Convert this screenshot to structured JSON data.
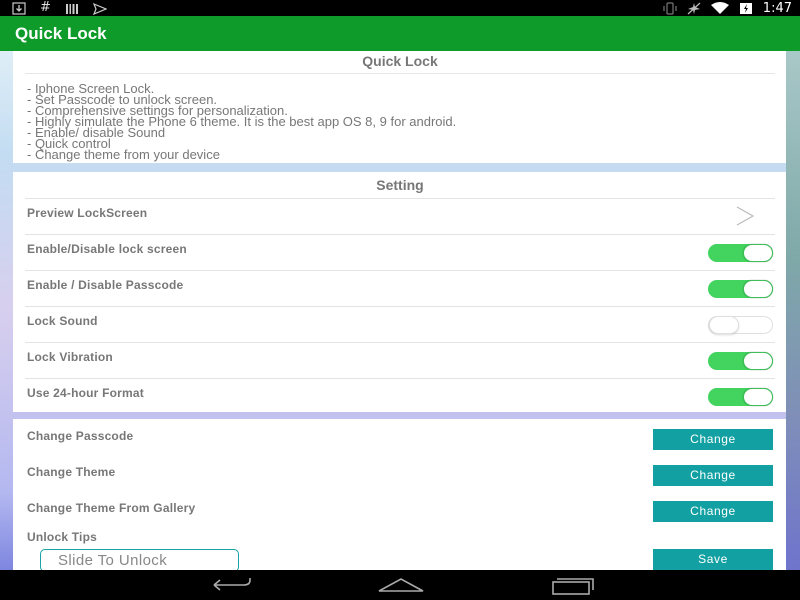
{
  "status_bar": {
    "time": "1:47",
    "left_icons": [
      "download-icon",
      "hashtag-icon",
      "barcode-icon",
      "send-icon"
    ],
    "right_icons": [
      "vibrate-icon",
      "airplane-icon",
      "wifi-icon",
      "battery-icon"
    ]
  },
  "app_bar": {
    "title": "Quick Lock"
  },
  "about": {
    "title": "Quick Lock",
    "lines": [
      "- Iphone Screen Lock.",
      "- Set Passcode to unlock screen.",
      "- Comprehensive settings for personalization.",
      "- Highly simulate the Phone 6 theme. It is the best app OS 8, 9 for android.",
      "- Enable/ disable Sound",
      "- Quick control",
      "- Change theme from your device"
    ]
  },
  "settings": {
    "title": "Setting",
    "rows": [
      {
        "label": "Preview LockScreen",
        "control": "chevron"
      },
      {
        "label": "Enable/Disable lock screen",
        "control": "toggle",
        "on": true
      },
      {
        "label": "Enable / Disable Passcode",
        "control": "toggle",
        "on": true
      },
      {
        "label": "Lock Sound",
        "control": "toggle",
        "on": false
      },
      {
        "label": "Lock Vibration",
        "control": "toggle",
        "on": true
      },
      {
        "label": "Use 24-hour Format",
        "control": "toggle",
        "on": true
      }
    ]
  },
  "actions": {
    "change_passcode": {
      "label": "Change Passcode",
      "button": "Change"
    },
    "change_theme": {
      "label": "Change Theme",
      "button": "Change"
    },
    "change_theme_gallery": {
      "label": "Change Theme From Gallery",
      "button": "Change"
    },
    "unlock_tips": {
      "label": "Unlock Tips",
      "value": "Slide To Unlock",
      "button": "Save"
    }
  },
  "colors": {
    "app_bar": "#0f9b2a",
    "toggle_on": "#43d35f",
    "button": "#13a0a3"
  }
}
